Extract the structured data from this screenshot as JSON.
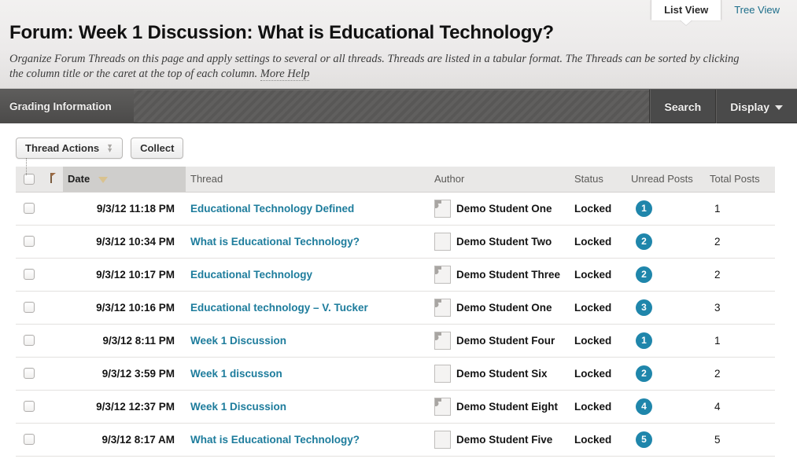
{
  "view_tabs": [
    {
      "label": "List View",
      "active": true
    },
    {
      "label": "Tree View",
      "active": false
    }
  ],
  "header": {
    "title": "Forum: Week 1 Discussion: What is Educational Technology?",
    "description": "Organize Forum Threads on this page and apply settings to several or all threads. Threads are listed in a tabular format. The Threads can be sorted by clicking the column title or the caret at the top of each column.",
    "more_help": "More Help"
  },
  "action_bar": {
    "tab_label": "Grading Information",
    "search_label": "Search",
    "display_label": "Display"
  },
  "toolbar": {
    "thread_actions_label": "Thread Actions",
    "collect_label": "Collect"
  },
  "table": {
    "columns": {
      "date": "Date",
      "thread": "Thread",
      "author": "Author",
      "status": "Status",
      "unread": "Unread Posts",
      "total": "Total Posts"
    },
    "sorted_column": "Date",
    "rows": [
      {
        "date": "9/3/12 11:18 PM",
        "thread": "Educational Technology Defined",
        "author": "Demo Student One",
        "avatar": "default",
        "status": "Locked",
        "unread": "1",
        "total": "1"
      },
      {
        "date": "9/3/12 10:34 PM",
        "thread": "What is Educational Technology?",
        "author": "Demo Student Two",
        "avatar": "photo-a",
        "status": "Locked",
        "unread": "2",
        "total": "2"
      },
      {
        "date": "9/3/12 10:17 PM",
        "thread": "Educational Technology",
        "author": "Demo Student Three",
        "avatar": "default",
        "status": "Locked",
        "unread": "2",
        "total": "2"
      },
      {
        "date": "9/3/12 10:16 PM",
        "thread": "Educational technology – V. Tucker",
        "author": "Demo Student One",
        "avatar": "default",
        "status": "Locked",
        "unread": "3",
        "total": "3"
      },
      {
        "date": "9/3/12 8:11 PM",
        "thread": "Week 1 Discussion",
        "author": "Demo Student Four",
        "avatar": "default",
        "status": "Locked",
        "unread": "1",
        "total": "1"
      },
      {
        "date": "9/3/12 3:59 PM",
        "thread": "Week 1 discusson",
        "author": "Demo Student Six",
        "avatar": "photo-b",
        "status": "Locked",
        "unread": "2",
        "total": "2"
      },
      {
        "date": "9/3/12 12:37 PM",
        "thread": "Week 1 Discussion",
        "author": "Demo Student Eight",
        "avatar": "default",
        "status": "Locked",
        "unread": "4",
        "total": "4"
      },
      {
        "date": "9/3/12 8:17 AM",
        "thread": "What is Educational Technology?",
        "author": "Demo Student Five",
        "avatar": "photo-c",
        "status": "Locked",
        "unread": "5",
        "total": "5"
      }
    ]
  },
  "icons": {
    "sort_caret": "caret-down-icon",
    "flag": "flag-icon",
    "chevron_down": "chevron-down-icon",
    "double_chevron": "double-chevron-down-icon"
  },
  "colors": {
    "link": "#1d7c9c",
    "badge": "#1f86ab",
    "dark_bar": "#4a4a4a",
    "sorted_header": "#cfcecc",
    "sort_caret": "#d9c28f"
  }
}
